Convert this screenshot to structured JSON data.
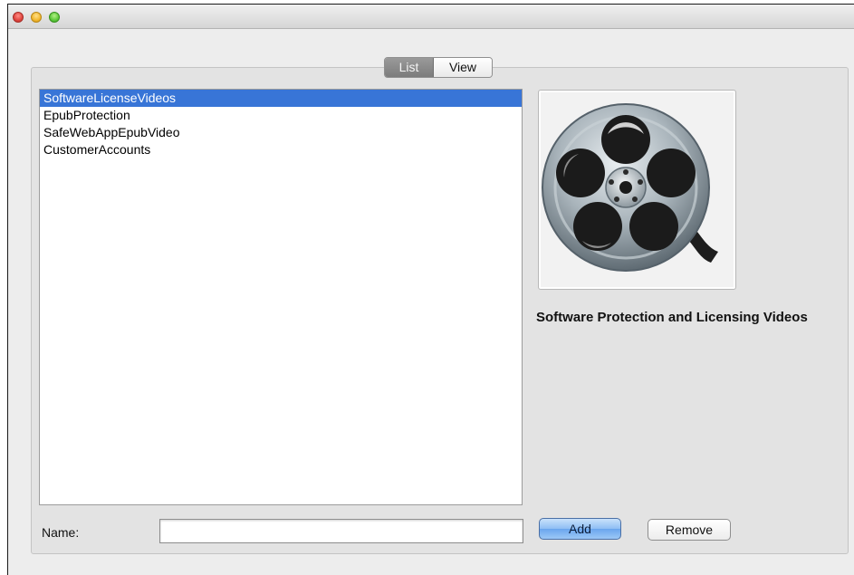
{
  "tabs": [
    {
      "label": "List",
      "selected": true
    },
    {
      "label": "View",
      "selected": false
    }
  ],
  "list": {
    "items": [
      "SoftwareLicenseVideos",
      "EpubProtection",
      "SafeWebAppEpubVideo",
      "CustomerAccounts"
    ],
    "selected_index": 0
  },
  "preview": {
    "icon": "film-reel-icon",
    "caption": "Software Protection and Licensing Videos"
  },
  "form": {
    "name_label": "Name:",
    "name_value": "",
    "add_label": "Add",
    "remove_label": "Remove"
  },
  "colors": {
    "selection": "#3875d7",
    "window_bg": "#ededed",
    "panel_bg": "#e3e3e3"
  }
}
